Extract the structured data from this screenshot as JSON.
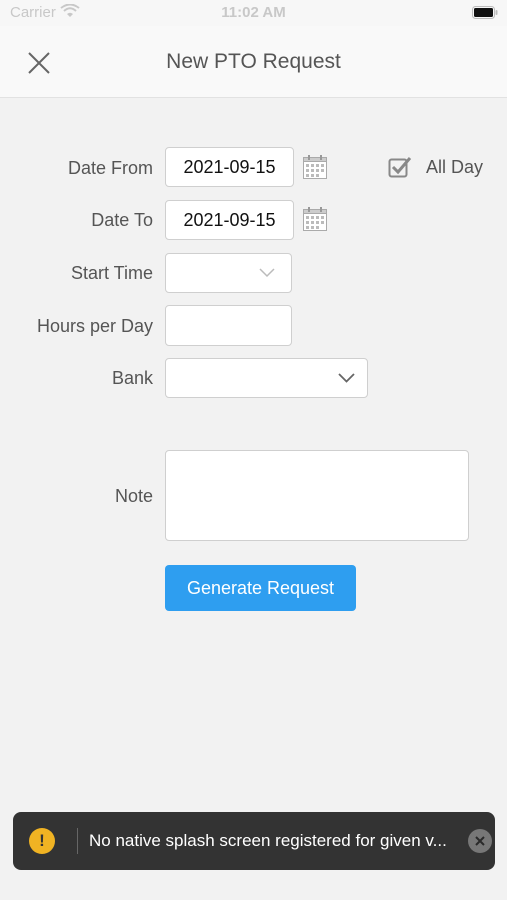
{
  "status_bar": {
    "carrier": "Carrier",
    "time": "11:02 AM"
  },
  "header": {
    "title": "New PTO Request",
    "close_icon": "close-icon"
  },
  "form": {
    "date_from": {
      "label": "Date From",
      "value": "2021-09-15"
    },
    "date_to": {
      "label": "Date To",
      "value": "2021-09-15"
    },
    "all_day": {
      "label": "All Day",
      "checked": true
    },
    "start_time": {
      "label": "Start Time",
      "value": ""
    },
    "hours_per_day": {
      "label": "Hours per Day",
      "value": ""
    },
    "bank": {
      "label": "Bank",
      "value": ""
    },
    "note": {
      "label": "Note",
      "value": ""
    },
    "submit_label": "Generate Request"
  },
  "toast": {
    "message": "No native splash screen registered for given v...",
    "icon": "warning-icon"
  },
  "colors": {
    "accent": "#2e9ef0",
    "background": "#f2f2f2",
    "toast_bg": "#333333",
    "warning": "#f0b323"
  }
}
